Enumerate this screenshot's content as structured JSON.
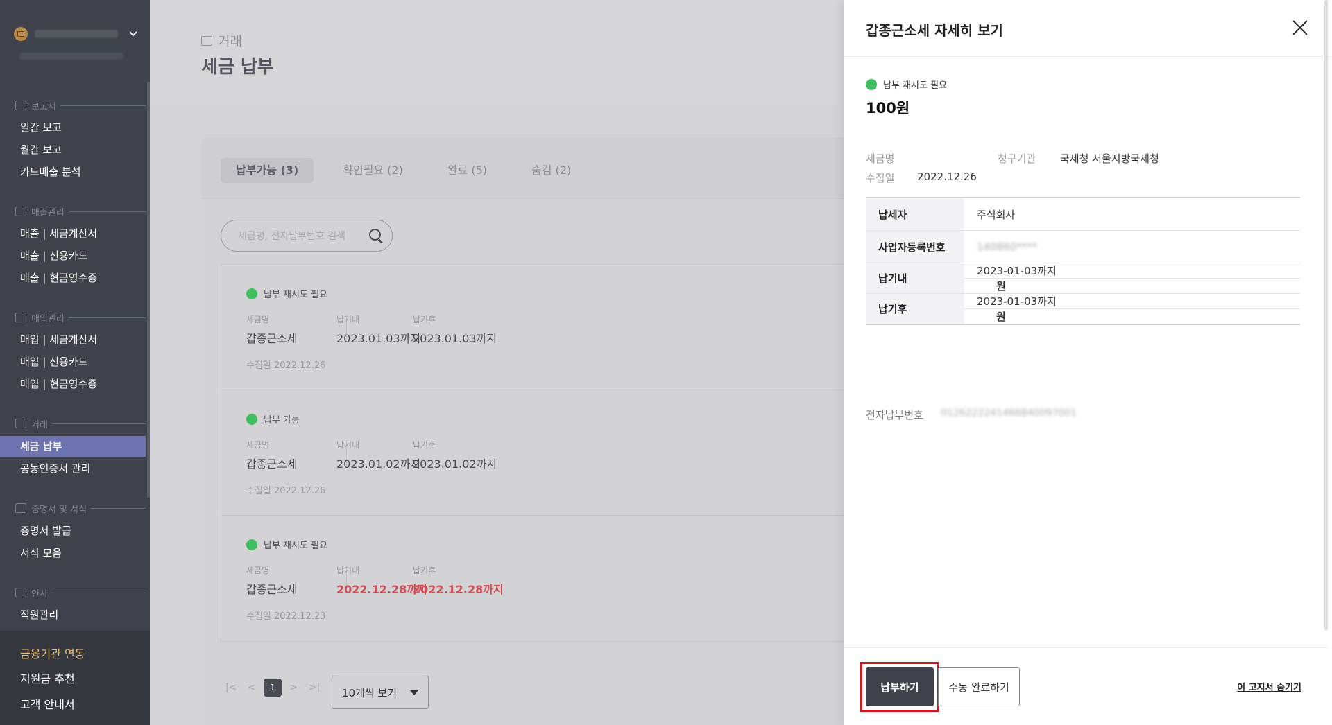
{
  "sidebar": {
    "sections": [
      {
        "label": "보고서",
        "items": [
          "일간 보고",
          "월간 보고",
          "카드매출 분석"
        ]
      },
      {
        "label": "매출관리",
        "items": [
          "매출 | 세금계산서",
          "매출 | 신용카드",
          "매출 | 현금영수증"
        ]
      },
      {
        "label": "매입관리",
        "items": [
          "매입 | 세금계산서",
          "매입 | 신용카드",
          "매입 | 현금영수증"
        ]
      },
      {
        "label": "거래",
        "items": [
          "세금 납부",
          "공동인증서 관리"
        ]
      },
      {
        "label": "증명서 및 서식",
        "items": [
          "증명서 발급",
          "서식 모음"
        ]
      },
      {
        "label": "인사",
        "items": [
          "직원관리"
        ]
      }
    ],
    "bottom": [
      "금융기관 연동",
      "지원금 추천",
      "고객 안내서"
    ]
  },
  "header": {
    "breadcrumb": "거래",
    "title": "세금 납부"
  },
  "tabs": [
    "납부가능 (3)",
    "확인필요 (2)",
    "완료 (5)",
    "숨김 (2)"
  ],
  "search": {
    "placeholder": "세금명, 전자납부번호 검색"
  },
  "labels": {
    "tax_name": "세금명",
    "due_before": "납기내",
    "due_after": "납기후"
  },
  "items": [
    {
      "status": "납부 재시도 필요",
      "name": "갑종근소세",
      "due_before": "2023.01.03까지",
      "due_after": "2023.01.03까지",
      "collected": "수집일 2022.12.26",
      "overdue": false
    },
    {
      "status": "납부 가능",
      "name": "갑종근소세",
      "due_before": "2023.01.02까지",
      "due_after": "2023.01.02까지",
      "collected": "수집일 2022.12.26",
      "overdue": false
    },
    {
      "status": "납부 재시도 필요",
      "name": "갑종근소세",
      "due_before": "2022.12.28까지",
      "due_after": "2022.12.28까지",
      "collected": "수집일 2022.12.23",
      "overdue": true
    }
  ],
  "pagination": {
    "first": "|<",
    "prev": "<",
    "current": "1",
    "next": ">",
    "last": ">|",
    "page_size": "10개씩 보기"
  },
  "drawer": {
    "title": "갑종근소세 자세히 보기",
    "status": "납부 재시도 필요",
    "amount": "100원",
    "meta": {
      "tax_name_label": "세금명",
      "agency_label": "청구기관",
      "agency_value": "국세청 서울지방국세청",
      "collected_label": "수집일",
      "collected_value": "2022.12.26"
    },
    "table": {
      "taxpayer_label": "납세자",
      "taxpayer_value": "주식회사",
      "bizno_label": "사업자등록번호",
      "bizno_value": "140860****",
      "before_label": "납기내",
      "before_date": "2023-01-03까지",
      "before_amount": "원",
      "after_label": "납기후",
      "after_date": "2023-01-03까지",
      "after_amount": "원"
    },
    "epay_label": "전자납부번호",
    "epay_value": "0126222241466840097001",
    "pay_button": "납부하기",
    "manual_button": "수동 완료하기",
    "hide_link": "이 고지서 숨기기"
  },
  "colors": {
    "status_dot": "#3fbf5f",
    "overdue": "#d24b53",
    "active_nav": "#6d73b0",
    "highlight_border": "#d0191f"
  }
}
